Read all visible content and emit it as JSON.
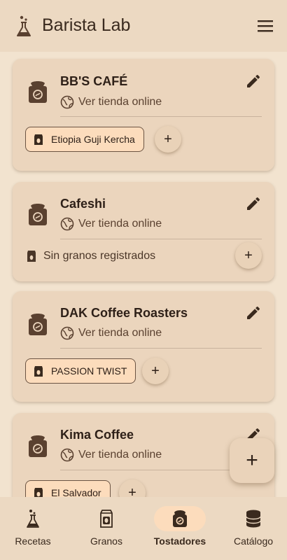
{
  "app": {
    "title": "Barista Lab"
  },
  "roasters": [
    {
      "name": "BB'S CAFÉ",
      "link": "Ver tienda online",
      "beans": [
        "Etiopia Guji Kercha"
      ]
    },
    {
      "name": "Cafeshi",
      "link": "Ver tienda online",
      "beans": [],
      "empty_text": "Sin granos registrados"
    },
    {
      "name": "DAK Coffee Roasters",
      "link": "Ver tienda online",
      "beans": [
        "PASSION TWIST"
      ]
    },
    {
      "name": "Kima Coffee",
      "link": "Ver tienda online",
      "beans": [
        "El Salvador"
      ]
    }
  ],
  "add_symbol": "+",
  "fab_symbol": "+",
  "nav": [
    {
      "label": "Recetas",
      "icon": "flask-icon",
      "active": false
    },
    {
      "label": "Granos",
      "icon": "coffee-bag-icon",
      "active": false
    },
    {
      "label": "Tostadores",
      "icon": "roaster-bag-icon",
      "active": true
    },
    {
      "label": "Catálogo",
      "icon": "database-icon",
      "active": false
    }
  ],
  "colors": {
    "background": "#f2e3cf",
    "card": "#ebd5bd",
    "chip": "#fcdcbc",
    "text": "#3a2a1e"
  }
}
